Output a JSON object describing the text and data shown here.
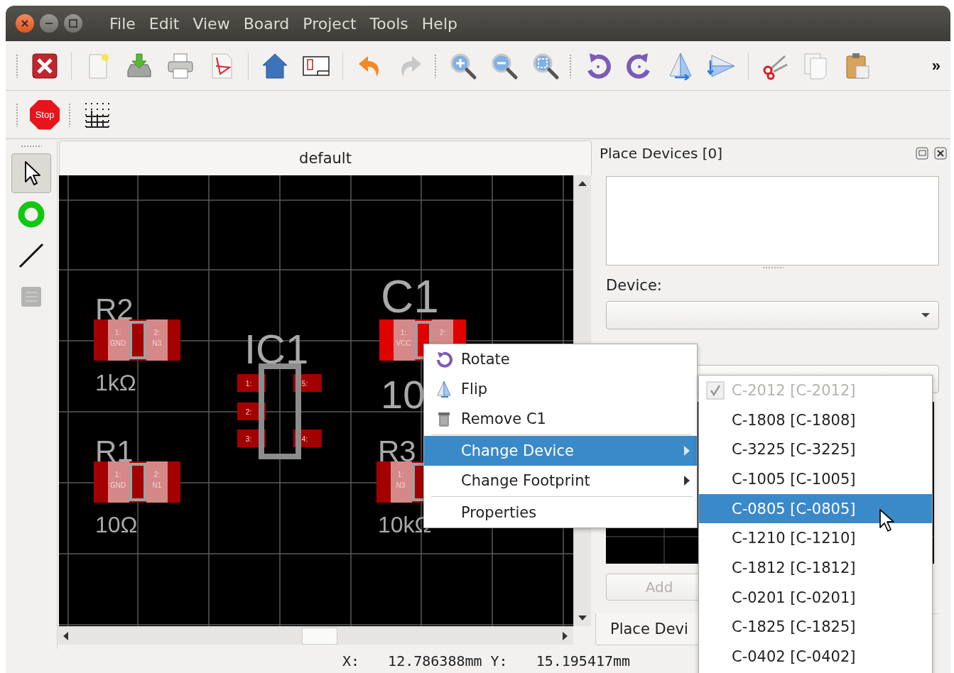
{
  "menu_bar": [
    "File",
    "Edit",
    "View",
    "Board",
    "Project",
    "Tools",
    "Help"
  ],
  "toolbar_main": {
    "groups": [
      [
        {
          "kind": "close",
          "disabled": false
        }
      ],
      [
        {
          "kind": "new",
          "disabled": false
        },
        {
          "kind": "download",
          "disabled": false
        },
        {
          "kind": "print",
          "disabled": false
        },
        {
          "kind": "pdf",
          "disabled": false
        }
      ],
      [
        {
          "kind": "home",
          "disabled": false
        },
        {
          "kind": "board",
          "disabled": false
        }
      ],
      [
        {
          "kind": "undo",
          "disabled": false
        },
        {
          "kind": "redo",
          "disabled": true
        }
      ],
      [
        {
          "kind": "zoom-in",
          "disabled": false
        },
        {
          "kind": "zoom-out",
          "disabled": false
        },
        {
          "kind": "zoom-fit",
          "disabled": false
        }
      ],
      [
        {
          "kind": "rotate-ccw",
          "disabled": false
        },
        {
          "kind": "rotate-cw",
          "disabled": false
        },
        {
          "kind": "flip-v",
          "disabled": false
        },
        {
          "kind": "flip-h",
          "disabled": false
        }
      ],
      [
        {
          "kind": "cut",
          "disabled": false
        },
        {
          "kind": "copy",
          "disabled": false
        },
        {
          "kind": "paste",
          "disabled": false
        }
      ]
    ],
    "overflow": "»"
  },
  "toolbar_secondary": {
    "groups": [
      [
        {
          "kind": "stop",
          "label": "Stop",
          "disabled": false
        }
      ],
      [
        {
          "kind": "grid",
          "disabled": false
        }
      ]
    ]
  },
  "tool_palette": [
    {
      "kind": "pointer",
      "selected": true,
      "disabled": false
    },
    {
      "kind": "via",
      "selected": false,
      "disabled": false
    },
    {
      "kind": "trace",
      "selected": false,
      "disabled": false
    },
    {
      "kind": "chip",
      "selected": false,
      "disabled": true
    }
  ],
  "editor": {
    "tab": "default",
    "components": [
      {
        "kind": "two-pad",
        "label": "R2",
        "value": "1kΩ",
        "selected": false,
        "pads": [
          {
            "number": "1:",
            "net": "GND"
          },
          {
            "number": "2:",
            "net": "N3"
          }
        ]
      },
      {
        "kind": "ic",
        "label": "IC1",
        "selected": false,
        "pads": [
          {
            "number": "1:"
          },
          {
            "number": "5:"
          },
          {
            "number": "2:"
          },
          {
            "number": "3:"
          },
          {
            "number": "4:"
          }
        ]
      },
      {
        "kind": "two-pad",
        "label": "C1",
        "value": "10",
        "selected": true,
        "pads": [
          {
            "number": "1:",
            "net": "VCC"
          },
          {
            "number": "2:"
          }
        ]
      },
      {
        "kind": "two-pad",
        "label": "R1",
        "value": "10Ω",
        "selected": false,
        "pads": [
          {
            "number": "1:",
            "net": "GND"
          },
          {
            "number": "2:",
            "net": "N1"
          }
        ]
      },
      {
        "kind": "two-pad",
        "label": "R3",
        "value": "10kΩ",
        "selected": false,
        "pads": [
          {
            "number": "1:",
            "net": "N3"
          }
        ]
      }
    ]
  },
  "dock": {
    "title": "Place Devices [0]",
    "device_label": "Device:",
    "add_button": {
      "label": "Add",
      "disabled": true
    },
    "bottom_tab": "Place Devi"
  },
  "context_menu": {
    "items": [
      {
        "kind": "rotate",
        "label": "Rotate",
        "selected": false
      },
      {
        "kind": "flip",
        "label": "Flip",
        "selected": false
      },
      {
        "kind": "remove",
        "label": "Remove C1",
        "selected": false
      },
      {
        "kind": "separator"
      },
      {
        "kind": "submenu",
        "label": "Change Device",
        "selected": true
      },
      {
        "kind": "submenu",
        "label": "Change Footprint",
        "selected": false
      },
      {
        "kind": "separator"
      },
      {
        "kind": "plain",
        "label": "Properties",
        "selected": false
      }
    ]
  },
  "submenu": {
    "items": [
      {
        "label": "C-2012 [C-2012]",
        "checked": true,
        "disabled": true,
        "selected": false
      },
      {
        "label": "C-1808 [C-1808]",
        "checked": false,
        "disabled": false,
        "selected": false
      },
      {
        "label": "C-3225 [C-3225]",
        "checked": false,
        "disabled": false,
        "selected": false
      },
      {
        "label": "C-1005 [C-1005]",
        "checked": false,
        "disabled": false,
        "selected": false
      },
      {
        "label": "C-0805 [C-0805]",
        "checked": false,
        "disabled": false,
        "selected": true
      },
      {
        "label": "C-1210 [C-1210]",
        "checked": false,
        "disabled": false,
        "selected": false
      },
      {
        "label": "C-1812 [C-1812]",
        "checked": false,
        "disabled": false,
        "selected": false
      },
      {
        "label": "C-0201 [C-0201]",
        "checked": false,
        "disabled": false,
        "selected": false
      },
      {
        "label": "C-1825 [C-1825]",
        "checked": false,
        "disabled": false,
        "selected": false
      },
      {
        "label": "C-0402 [C-0402]",
        "checked": false,
        "disabled": false,
        "selected": false
      }
    ]
  },
  "status_bar": {
    "x_label": "X:",
    "x_value": "12.786388mm",
    "y_label": "Y:",
    "y_value": "15.195417mm"
  }
}
